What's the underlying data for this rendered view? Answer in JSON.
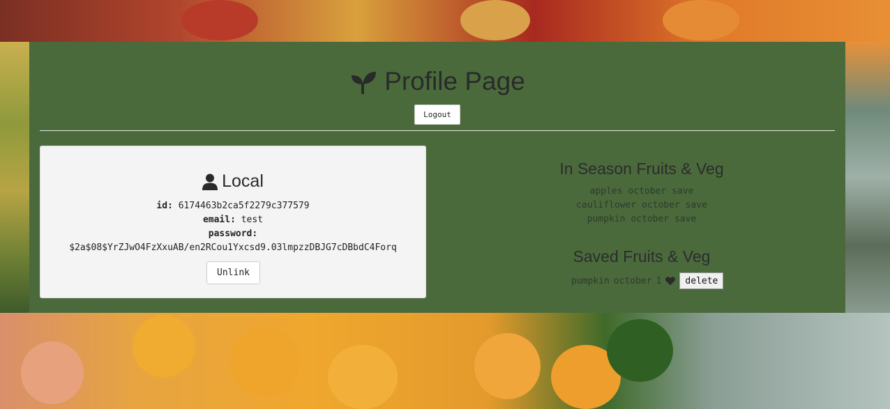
{
  "header": {
    "title": "Profile Page",
    "logout_label": "Logout"
  },
  "local": {
    "title": "Local",
    "id_label": "id:",
    "id_value": "6174463b2ca5f2279c377579",
    "email_label": "email:",
    "email_value": "test",
    "password_label": "password:",
    "password_value": "$2a$08$YrZJwO4FzXxuAB/en2RCou1Yxcsd9.03lmpzzDBJG7cDBbdC4Forq",
    "unlink_label": "Unlink"
  },
  "in_season": {
    "title": "In Season Fruits & Veg",
    "items": [
      {
        "name": "apples",
        "month": "october",
        "action": "save"
      },
      {
        "name": "cauliflower",
        "month": "october",
        "action": "save"
      },
      {
        "name": "pumpkin",
        "month": "october",
        "action": "save"
      }
    ]
  },
  "saved": {
    "title": "Saved Fruits & Veg",
    "items": [
      {
        "name": "pumpkin",
        "month": "october",
        "count": "1",
        "delete_label": "delete"
      }
    ]
  },
  "icons": {
    "title_icon": "seedling-icon",
    "local_icon": "user-icon",
    "saved_icon": "heart-icon"
  },
  "colors": {
    "panel": "#4a6a3c",
    "card": "#f4f4f4",
    "text": "#2a2a2a"
  }
}
